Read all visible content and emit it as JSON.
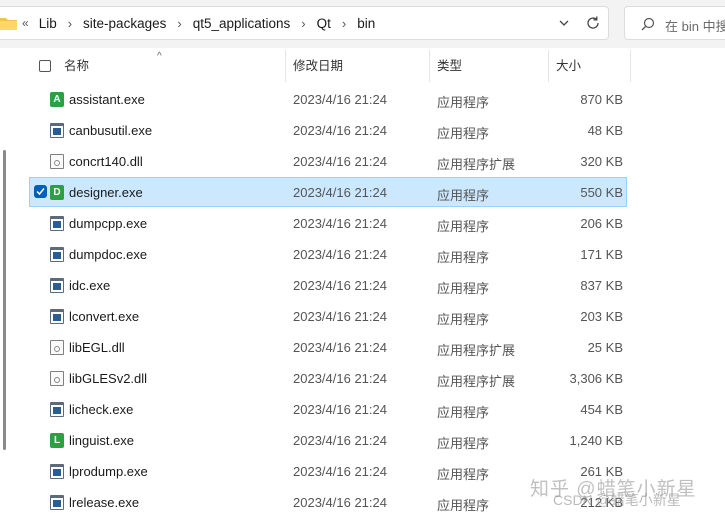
{
  "address_bar": {
    "overflow": "«",
    "crumbs": [
      "Lib",
      "site-packages",
      "qt5_applications",
      "Qt",
      "bin"
    ],
    "separator": "›"
  },
  "search": {
    "placeholder": "在 bin 中搜"
  },
  "columns": {
    "name": "名称",
    "modified": "修改日期",
    "type": "类型",
    "size": "大小"
  },
  "files": [
    {
      "name": "assistant.exe",
      "modified": "2023/4/16 21:24",
      "type": "应用程序",
      "size": "870 KB",
      "icon": "green-app-icon",
      "icon_letter": "A",
      "icon_color": "#2ea043"
    },
    {
      "name": "canbusutil.exe",
      "modified": "2023/4/16 21:24",
      "type": "应用程序",
      "size": "48 KB",
      "icon": "exe-icon"
    },
    {
      "name": "concrt140.dll",
      "modified": "2023/4/16 21:24",
      "type": "应用程序扩展",
      "size": "320 KB",
      "icon": "dll-icon"
    },
    {
      "name": "designer.exe",
      "modified": "2023/4/16 21:24",
      "type": "应用程序",
      "size": "550 KB",
      "icon": "green-app-icon",
      "icon_letter": "D",
      "icon_color": "#2ea043",
      "selected": true
    },
    {
      "name": "dumpcpp.exe",
      "modified": "2023/4/16 21:24",
      "type": "应用程序",
      "size": "206 KB",
      "icon": "exe-icon"
    },
    {
      "name": "dumpdoc.exe",
      "modified": "2023/4/16 21:24",
      "type": "应用程序",
      "size": "171 KB",
      "icon": "exe-icon"
    },
    {
      "name": "idc.exe",
      "modified": "2023/4/16 21:24",
      "type": "应用程序",
      "size": "837 KB",
      "icon": "exe-icon"
    },
    {
      "name": "lconvert.exe",
      "modified": "2023/4/16 21:24",
      "type": "应用程序",
      "size": "203 KB",
      "icon": "exe-icon"
    },
    {
      "name": "libEGL.dll",
      "modified": "2023/4/16 21:24",
      "type": "应用程序扩展",
      "size": "25 KB",
      "icon": "dll-icon"
    },
    {
      "name": "libGLESv2.dll",
      "modified": "2023/4/16 21:24",
      "type": "应用程序扩展",
      "size": "3,306 KB",
      "icon": "dll-icon"
    },
    {
      "name": "licheck.exe",
      "modified": "2023/4/16 21:24",
      "type": "应用程序",
      "size": "454 KB",
      "icon": "exe-icon"
    },
    {
      "name": "linguist.exe",
      "modified": "2023/4/16 21:24",
      "type": "应用程序",
      "size": "1,240 KB",
      "icon": "green-app-icon",
      "icon_letter": "L",
      "icon_color": "#2ea043"
    },
    {
      "name": "lprodump.exe",
      "modified": "2023/4/16 21:24",
      "type": "应用程序",
      "size": "261 KB",
      "icon": "exe-icon"
    },
    {
      "name": "lrelease.exe",
      "modified": "2023/4/16 21:24",
      "type": "应用程序",
      "size": "212 KB",
      "icon": "exe-icon"
    }
  ],
  "watermark": {
    "line1": "知乎 @蜡笔小新星",
    "line2": "CSDN @蜡笔小新星"
  },
  "colors": {
    "selection_bg": "#cce8ff",
    "selection_border": "#99d1ff",
    "accent": "#005fb8"
  }
}
